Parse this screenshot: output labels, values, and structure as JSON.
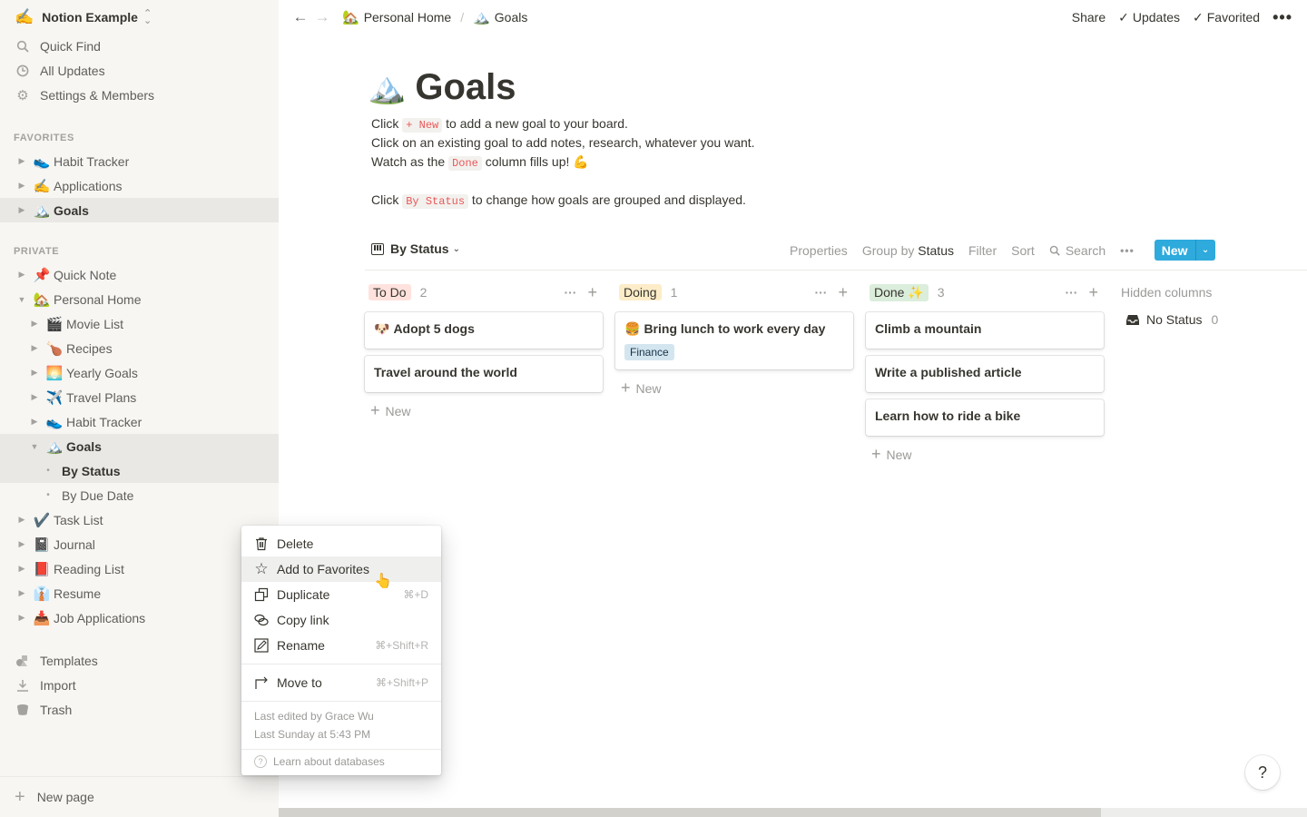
{
  "workspace": {
    "emoji": "✍️",
    "name": "Notion Example"
  },
  "sidebar": {
    "top_items": [
      {
        "icon": "search-icon",
        "label": "Quick Find"
      },
      {
        "icon": "clock-icon",
        "label": "All Updates"
      },
      {
        "icon": "gear-icon",
        "label": "Settings & Members"
      }
    ],
    "favorites_label": "FAVORITES",
    "favorites": [
      {
        "emoji": "👟",
        "label": "Habit Tracker"
      },
      {
        "emoji": "✍️",
        "label": "Applications"
      },
      {
        "emoji": "🏔️",
        "label": "Goals",
        "selected": true
      }
    ],
    "private_label": "PRIVATE",
    "private": [
      {
        "emoji": "📌",
        "label": "Quick Note"
      },
      {
        "emoji": "🏡",
        "label": "Personal Home",
        "expanded": true
      },
      {
        "emoji": "🎬",
        "label": "Movie List"
      },
      {
        "emoji": "🍗",
        "label": "Recipes"
      },
      {
        "emoji": "🌅",
        "label": "Yearly Goals"
      },
      {
        "emoji": "✈️",
        "label": "Travel Plans"
      },
      {
        "emoji": "👟",
        "label": "Habit Tracker"
      },
      {
        "emoji": "🏔️",
        "label": "Goals",
        "expanded": true,
        "selected": true
      },
      {
        "label": "By Status",
        "selected": true
      },
      {
        "label": "By Due Date"
      },
      {
        "emoji": "✔️",
        "label": "Task List"
      },
      {
        "emoji": "📓",
        "label": "Journal"
      },
      {
        "emoji": "📕",
        "label": "Reading List"
      },
      {
        "emoji": "👔",
        "label": "Resume"
      },
      {
        "emoji": "📥",
        "label": "Job Applications"
      }
    ],
    "bottom_items": [
      {
        "icon": "templates-icon",
        "label": "Templates"
      },
      {
        "icon": "import-icon",
        "label": "Import"
      },
      {
        "icon": "trash-icon",
        "label": "Trash"
      }
    ],
    "new_page_label": "New page"
  },
  "topbar": {
    "breadcrumb": [
      {
        "emoji": "🏡",
        "label": "Personal Home"
      },
      {
        "emoji": "🏔️",
        "label": "Goals"
      }
    ],
    "separator": "/",
    "share_label": "Share",
    "updates_label": "Updates",
    "favorited_label": "Favorited"
  },
  "page": {
    "emoji": "🏔️",
    "title": "Goals",
    "lines": [
      {
        "pre": "Click ",
        "code": "+ New",
        "post": " to add a new goal to your board."
      },
      {
        "pre": "Click on an existing goal to add notes, research, whatever you want.",
        "code": "",
        "post": ""
      },
      {
        "pre": "Watch as the ",
        "code": "Done",
        "post": " column fills up! 💪"
      },
      {
        "pre": "Click ",
        "code": "By Status",
        "post": " to change how goals are grouped and displayed."
      }
    ]
  },
  "database": {
    "view_name": "By Status",
    "toolbar": {
      "properties": "Properties",
      "group_by_prefix": "Group by",
      "group_by_value": "Status",
      "filter": "Filter",
      "sort": "Sort",
      "search": "Search",
      "new": "New"
    },
    "columns": [
      {
        "name": "To Do",
        "color": "#ffe2dd",
        "count": "2",
        "cards": [
          {
            "emoji": "🐶",
            "title": "Adopt 5 dogs"
          },
          {
            "emoji": "",
            "title": "Travel around the world"
          }
        ]
      },
      {
        "name": "Doing",
        "color": "#fdecc8",
        "count": "1",
        "cards": [
          {
            "emoji": "🍔",
            "title": "Bring lunch to work every day",
            "tag": "Finance"
          }
        ]
      },
      {
        "name": "Done ✨",
        "color": "#dbeddb",
        "count": "3",
        "cards": [
          {
            "emoji": "",
            "title": "Climb a mountain"
          },
          {
            "emoji": "",
            "title": "Write a published article"
          },
          {
            "emoji": "",
            "title": "Learn how to ride a bike"
          }
        ]
      }
    ],
    "new_card_label": "New",
    "hidden_columns_label": "Hidden columns",
    "hidden": [
      {
        "name": "No Status",
        "count": "0"
      }
    ]
  },
  "context_menu": {
    "items": [
      {
        "icon": "trash-icon",
        "label": "Delete",
        "shortcut": ""
      },
      {
        "icon": "star-icon",
        "label": "Add to Favorites",
        "shortcut": "",
        "hovered": true
      },
      {
        "icon": "duplicate-icon",
        "label": "Duplicate",
        "shortcut": "⌘+D"
      },
      {
        "icon": "link-icon",
        "label": "Copy link",
        "shortcut": ""
      },
      {
        "icon": "pencil-icon",
        "label": "Rename",
        "shortcut": "⌘+Shift+R"
      },
      {
        "icon": "move-icon",
        "label": "Move to",
        "shortcut": "⌘+Shift+P"
      }
    ],
    "last_edited_by": "Last edited by Grace Wu",
    "last_edited_at": "Last Sunday at 5:43 PM",
    "learn_label": "Learn about databases"
  },
  "help_label": "?",
  "horizontal_scroll_fraction": 0.8
}
